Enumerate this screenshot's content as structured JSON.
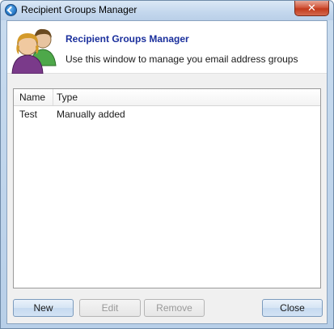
{
  "window": {
    "title": "Recipient Groups Manager"
  },
  "header": {
    "title": "Recipient Groups Manager",
    "subtitle": "Use this window to manage you email address groups"
  },
  "list": {
    "columns": [
      "Name",
      "Type"
    ],
    "rows": [
      {
        "name": "Test",
        "type": "Manually added"
      }
    ]
  },
  "buttons": {
    "new": "New",
    "edit": "Edit",
    "remove": "Remove",
    "close": "Close"
  },
  "icons": {
    "app": "app-icon",
    "people": "people-group-icon",
    "close": "close-icon"
  }
}
